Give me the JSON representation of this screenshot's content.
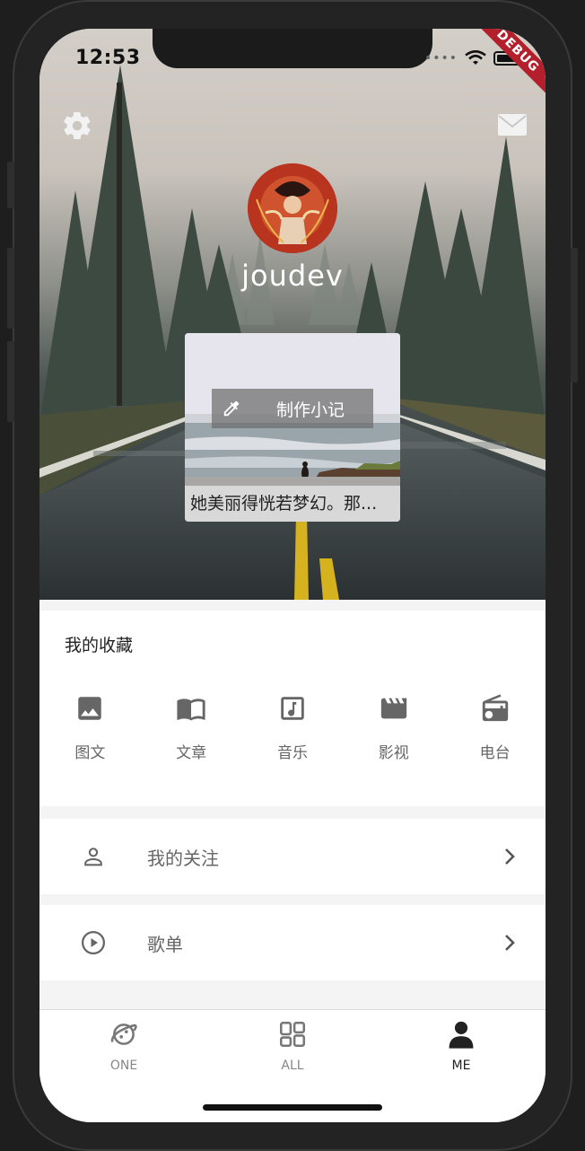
{
  "status_bar": {
    "time": "12:53",
    "debug_label": "DEBUG"
  },
  "header": {
    "username": "joudev",
    "settings_icon": "gear-icon",
    "mail_icon": "mail-icon"
  },
  "note_card": {
    "button_label": "制作小记",
    "caption": "她美丽得恍若梦幻。那..."
  },
  "favorites": {
    "title": "我的收藏",
    "items": [
      {
        "label": "图文",
        "icon": "image-icon"
      },
      {
        "label": "文章",
        "icon": "book-icon"
      },
      {
        "label": "音乐",
        "icon": "music-icon"
      },
      {
        "label": "影视",
        "icon": "clapper-icon"
      },
      {
        "label": "电台",
        "icon": "radio-icon"
      }
    ]
  },
  "menu": [
    {
      "label": "我的关注",
      "icon": "person-icon"
    },
    {
      "label": "歌单",
      "icon": "play-circle-icon"
    }
  ],
  "tabbar": {
    "tabs": [
      {
        "label": "ONE",
        "icon": "planet-icon"
      },
      {
        "label": "ALL",
        "icon": "grid-icon"
      },
      {
        "label": "ME",
        "icon": "person-filled-icon"
      }
    ],
    "active": "ME"
  },
  "colors": {
    "accent": "#222222",
    "muted": "#666666",
    "debug": "#b3202b"
  }
}
